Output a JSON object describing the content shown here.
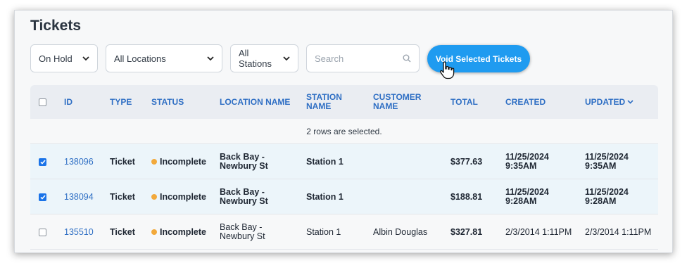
{
  "page": {
    "title": "Tickets"
  },
  "filters": {
    "status": "On Hold",
    "location": "All Locations",
    "station": "All Stations",
    "search_placeholder": "Search"
  },
  "actions": {
    "void_label": "Void Selected Tickets"
  },
  "colors": {
    "accent": "#1f9bf0",
    "link": "#2f6fc4",
    "status_incomplete": "#f2a93b"
  },
  "table": {
    "headers": {
      "id": "ID",
      "type": "TYPE",
      "status": "STATUS",
      "location": "LOCATION NAME",
      "station_line1": "STATION",
      "station_line2": "NAME",
      "customer_line1": "CUSTOMER",
      "customer_line2": "NAME",
      "total": "TOTAL",
      "created": "CREATED",
      "updated": "UPDATED"
    },
    "selection_note": "2 rows are selected.",
    "rows": [
      {
        "checked": true,
        "id": "138096",
        "type": "Ticket",
        "status": "Incomplete",
        "location_line1": "Back Bay -",
        "location_line2": "Newbury St",
        "station": "Station 1",
        "customer": "",
        "total": "$377.63",
        "created_line1": "11/25/2024",
        "created_line2": "9:35AM",
        "updated_line1": "11/25/2024",
        "updated_line2": "9:35AM"
      },
      {
        "checked": true,
        "id": "138094",
        "type": "Ticket",
        "status": "Incomplete",
        "location_line1": "Back Bay -",
        "location_line2": "Newbury St",
        "station": "Station 1",
        "customer": "",
        "total": "$188.81",
        "created_line1": "11/25/2024",
        "created_line2": "9:28AM",
        "updated_line1": "11/25/2024",
        "updated_line2": "9:28AM"
      },
      {
        "checked": false,
        "id": "135510",
        "type": "Ticket",
        "status": "Incomplete",
        "location_line1": "Back Bay -",
        "location_line2": "Newbury St",
        "station": "Station 1",
        "customer": "Albin Douglas",
        "total": "$327.81",
        "created_line1": "2/3/2014 1:11PM",
        "created_line2": "",
        "updated_line1": "2/3/2014 1:11PM",
        "updated_line2": ""
      }
    ]
  }
}
